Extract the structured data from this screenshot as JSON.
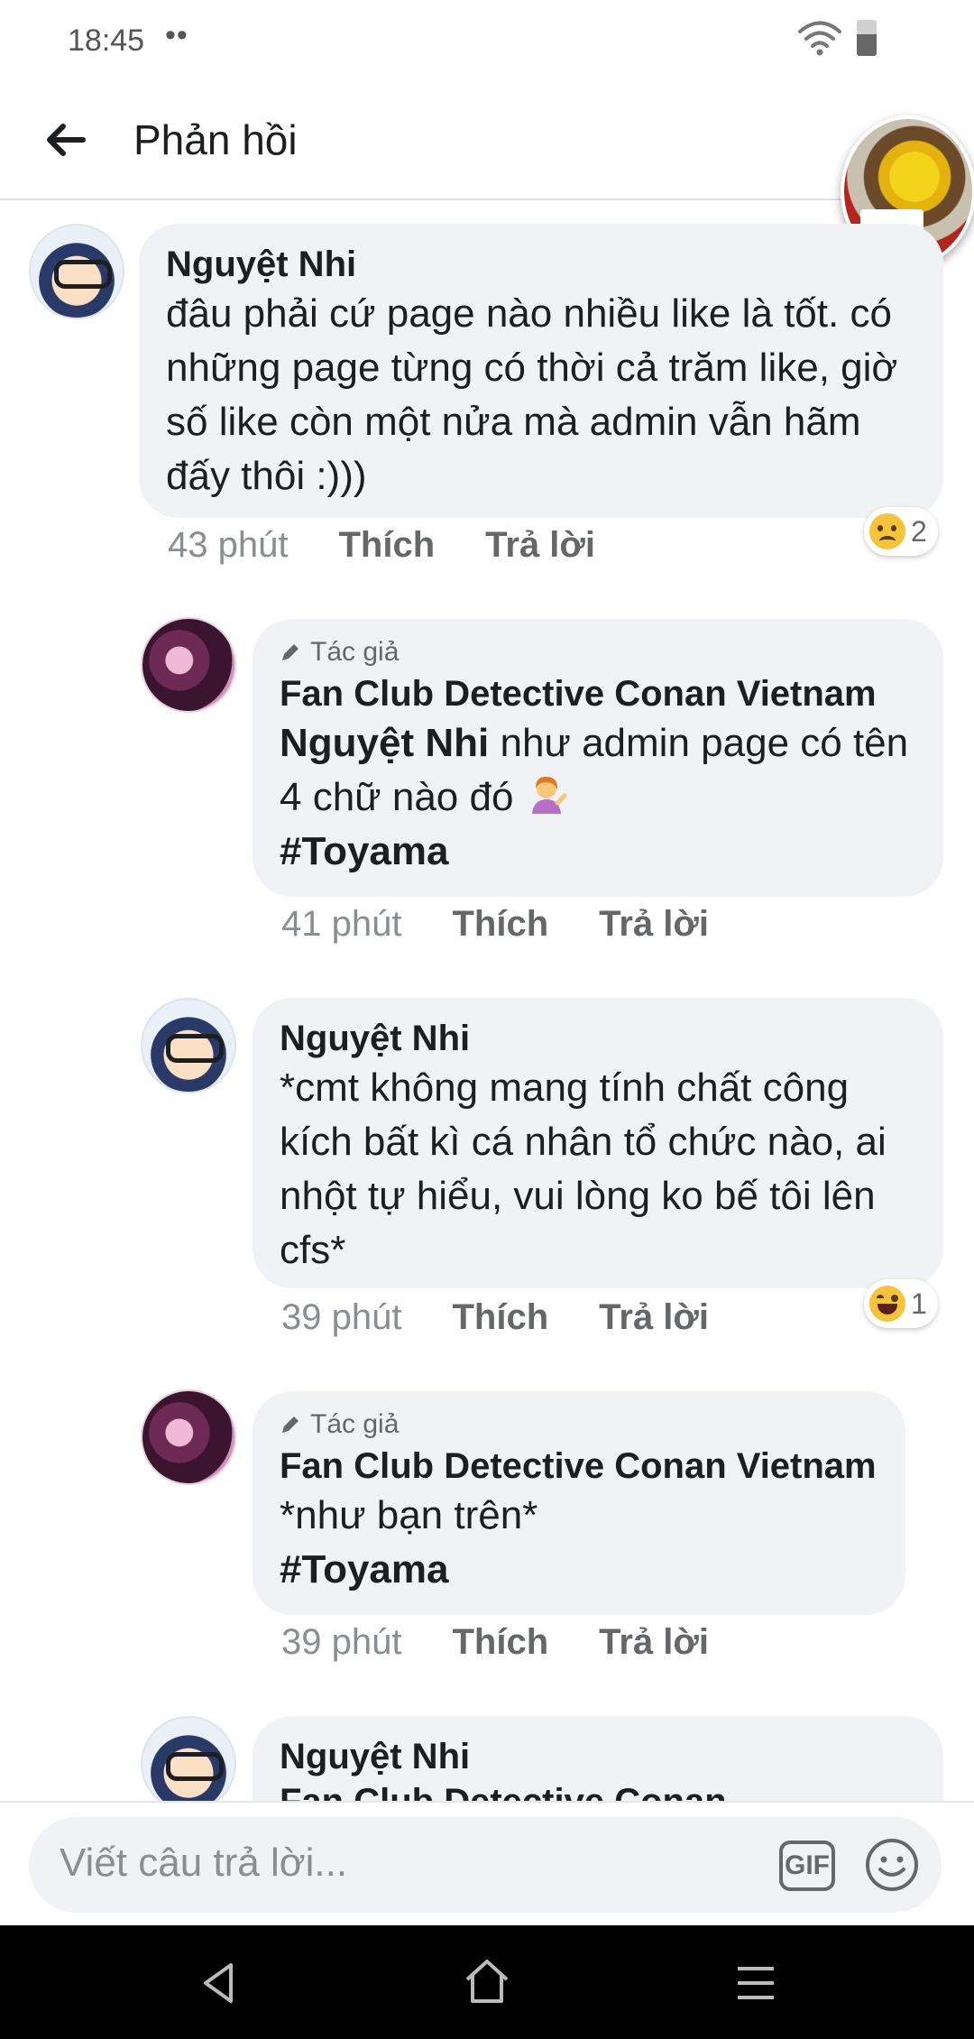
{
  "status_bar": {
    "time": "18:45",
    "indicator": "••"
  },
  "header": {
    "title": "Phản hồi"
  },
  "comments": [
    {
      "name": "Nguyệt Nhi",
      "text": "đâu phải cứ page nào nhiều like là tốt. có những page từng có thời cả trăm like, giờ số like còn một nửa mà admin vẫn hãm đấy thôi :)))",
      "time": "43 phút",
      "like_label": "Thích",
      "reply_label": "Trả lời",
      "reaction": {
        "type": "sad",
        "count": "2"
      }
    },
    {
      "badge": "Tác giả",
      "name": "Fan Club Detective Conan Vietnam",
      "mention": "Nguyệt Nhi",
      "text": "như admin page có tên 4 chữ nào đó",
      "hashtag": "#Toyama",
      "time": "41 phút",
      "like_label": "Thích",
      "reply_label": "Trả lời"
    },
    {
      "name": "Nguyệt Nhi",
      "text": "*cmt không mang tính chất công kích bất kì cá nhân tổ chức nào, ai nhột tự hiểu, vui lòng ko bế tôi lên cfs*",
      "time": "39 phút",
      "like_label": "Thích",
      "reply_label": "Trả lời",
      "reaction": {
        "type": "haha",
        "count": "1"
      }
    },
    {
      "badge": "Tác giả",
      "name": "Fan Club Detective Conan Vietnam",
      "text": "*như bạn trên*",
      "hashtag": "#Toyama",
      "time": "39 phút",
      "like_label": "Thích",
      "reply_label": "Trả lời"
    },
    {
      "name": "Nguyệt Nhi",
      "partial_text": "Fan Club Detective Conan"
    }
  ],
  "composer": {
    "placeholder": "Viết câu trả lời...",
    "gif_label": "GIF"
  },
  "colors": {
    "bubble": "#f0f2f5",
    "meta": "#8a8d91",
    "action": "#65676b",
    "nav_bar": "#000000"
  },
  "icons": [
    "back-arrow-icon",
    "wifi-icon",
    "battery-icon",
    "pencil-icon",
    "gif-icon",
    "smiley-icon",
    "nav-back-icon",
    "nav-home-icon",
    "nav-menu-icon"
  ]
}
